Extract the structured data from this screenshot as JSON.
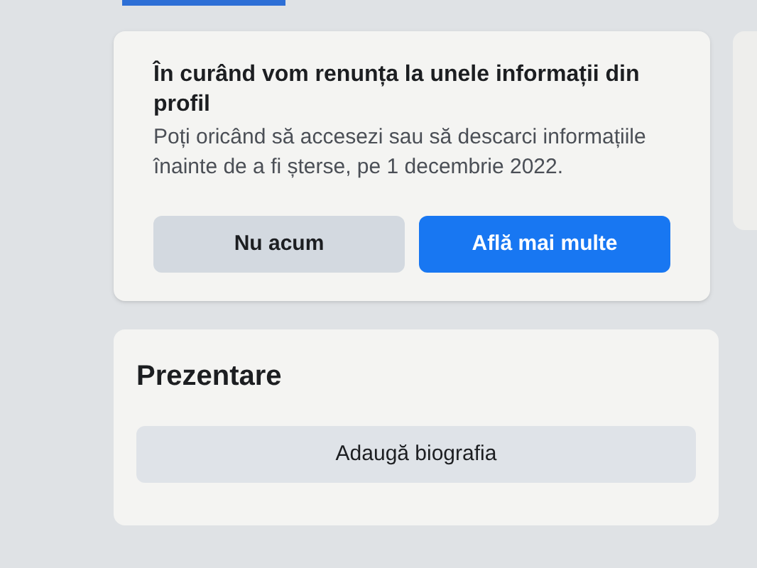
{
  "notice": {
    "title": "În curând vom renunța la unele informații din profil",
    "body": "Poți oricând să accesezi sau să descarci informațiile înainte de a fi șterse, pe 1 decembrie 2022.",
    "buttons": [
      {
        "label": "Nu acum",
        "kind": "secondary"
      },
      {
        "label": "Află mai multe",
        "kind": "primary"
      }
    ]
  },
  "intro": {
    "title": "Prezentare",
    "button": "Adaugă biografia"
  }
}
